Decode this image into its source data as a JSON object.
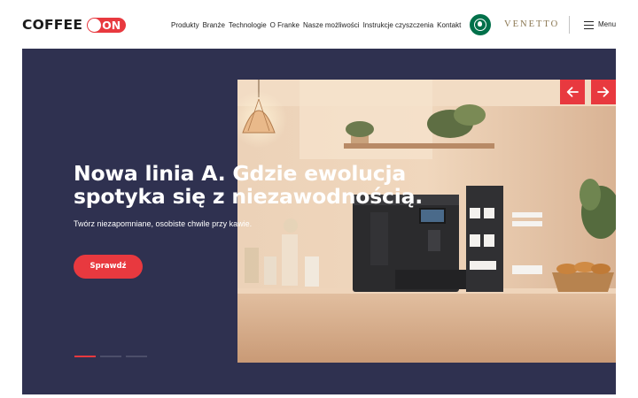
{
  "brand": {
    "logo_text": "COFFEE",
    "logo_switch_text": "ON",
    "accent_color": "#e8393f",
    "hero_background": "#2f3150"
  },
  "nav": {
    "items": [
      {
        "label": "Produkty"
      },
      {
        "label": "Branże"
      },
      {
        "label": "Technologie"
      },
      {
        "label": "O Franke"
      },
      {
        "label": "Nasze możliwości"
      },
      {
        "label": "Instrukcje czyszczenia"
      },
      {
        "label": "Kontakt"
      }
    ]
  },
  "partners": {
    "starbucks_icon": "starbucks-logo",
    "venetto": "VENETTO"
  },
  "menu": {
    "label": "Menu",
    "icon": "hamburger-icon"
  },
  "hero": {
    "heading": "Nowa linia A. Gdzie ewolucja spotyka się z niezawodnością.",
    "subtitle": "Twórz niezapomniane, osobiste chwile przy kawie.",
    "cta_label": "Sprawdź",
    "slides_count": 3,
    "active_slide": 1,
    "prev_icon": "arrow-left-icon",
    "next_icon": "arrow-right-icon"
  }
}
